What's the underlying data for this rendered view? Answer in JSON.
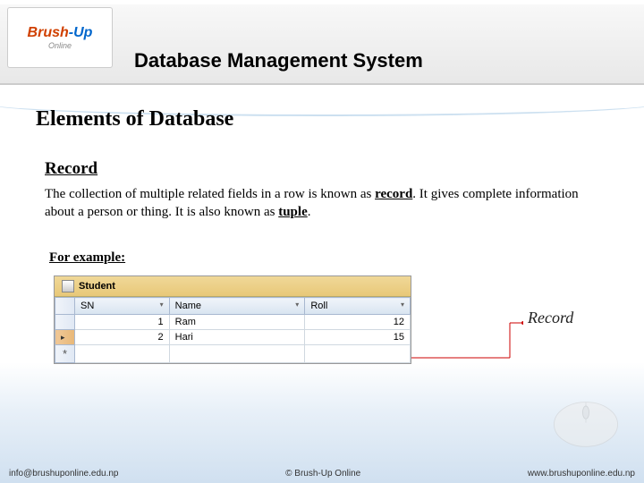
{
  "header": {
    "title": "Database Management System",
    "logo_brand_1": "Brush",
    "logo_brand_2": "-Up",
    "logo_sub": "Online"
  },
  "subtitle": "Elements of Database",
  "section": {
    "heading": "Record",
    "body_pre": "The collection of multiple related fields in a row is known as ",
    "body_term1": "record",
    "body_mid": ". It gives complete information about a person or thing. It is also known as ",
    "body_term2": "tuple",
    "body_post": ".",
    "example_label": "For example:"
  },
  "table": {
    "tab_name": "Student",
    "columns": [
      "SN",
      "Name",
      "Roll"
    ],
    "rows": [
      {
        "sn": "1",
        "name": "Ram",
        "roll": "12",
        "highlighted": false
      },
      {
        "sn": "2",
        "name": "Hari",
        "roll": "15",
        "highlighted": true
      }
    ],
    "new_row_marker": "*"
  },
  "callout": {
    "label": "Record"
  },
  "footer": {
    "left": "info@brushuponline.edu.np",
    "center": "© Brush-Up Online",
    "right": "www.brushuponline.edu.np"
  },
  "chart_data": {
    "type": "table",
    "title": "Student",
    "columns": [
      "SN",
      "Name",
      "Roll"
    ],
    "rows": [
      [
        1,
        "Ram",
        12
      ],
      [
        2,
        "Hari",
        15
      ]
    ]
  }
}
